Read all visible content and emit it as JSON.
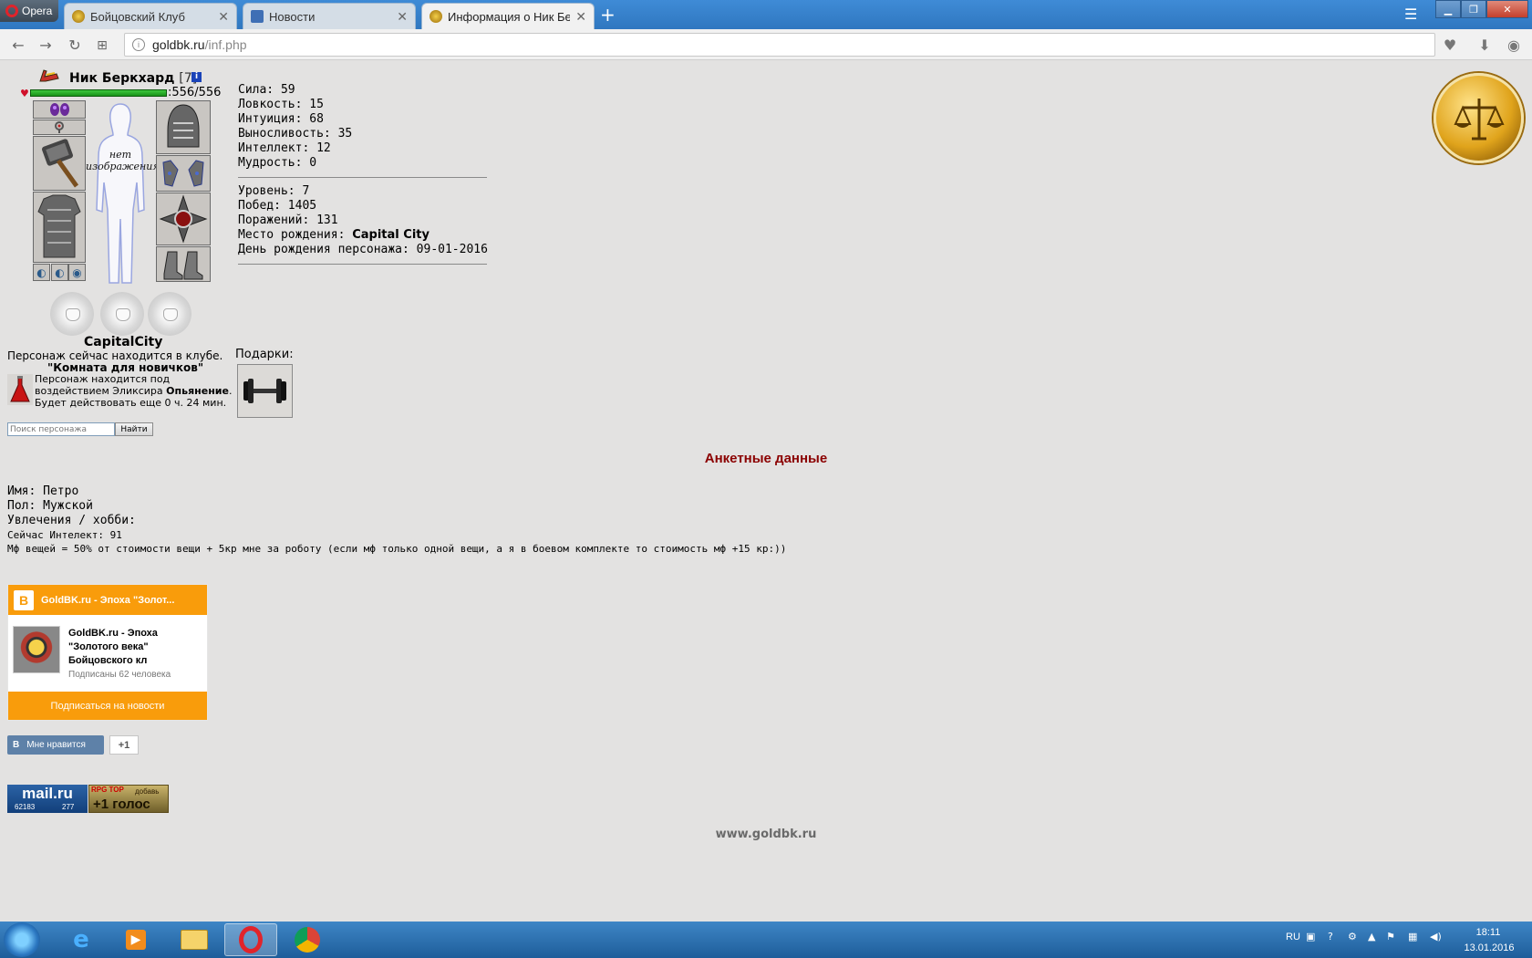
{
  "browser": {
    "menu_label": "Opera",
    "tabs": [
      {
        "title": "Бойцовский Клуб"
      },
      {
        "title": "Новости"
      },
      {
        "title": "Информация о Ник Берк"
      }
    ],
    "url_host": "goldbk.ru",
    "url_path": "/inf.php"
  },
  "character": {
    "name": "Ник Беркхард",
    "level": "[7]",
    "hp_text": ":556/556",
    "hp_fraction": 1.0,
    "no_image_text_1": "нет",
    "no_image_text_2": "изображения",
    "city": "CapitalCity",
    "club_line": "Персонаж сейчас находится в клубе.",
    "room": "\"Комната для новичков\"",
    "elixir_1": "Персонаж находится под",
    "elixir_2": "воздействием Эликсира",
    "elixir_name": "Опьянение",
    "elixir_3": "Будет действовать еще 0 ч. 24 мин.",
    "gifts_label": "Подарки:"
  },
  "stats": {
    "strength": "Сила: 59",
    "agility": "Ловкость: 15",
    "intuition": "Интуиция: 68",
    "endurance": "Выносливость: 35",
    "intellect": "Интеллект: 12",
    "wisdom": "Мудрость: 0",
    "level": "Уровень: 7",
    "wins": "Побед: 1405",
    "losses": "Поражений: 131",
    "birthplace_label": "Место рождения: ",
    "birthplace_value": "Capital City",
    "birthday": "День рождения персонажа: 09-01-2016"
  },
  "search": {
    "placeholder": "Поиск персонажа",
    "button": "Найти"
  },
  "anket": {
    "title": "Анкетные данные",
    "name": "Имя: Петро",
    "gender": "Пол: Мужской",
    "hobby": "Увлечения / хобби:",
    "line1": "Сейчас Интелект: 91",
    "line2": "Мф вещей = 50% от стоимости вещи + 5кр мне за роботу (если мф только одной вещи, а я в боевом комплекте то стоимость мф +15 кр:))"
  },
  "vk_widget": {
    "logo": "B",
    "header": "GoldBK.ru - Эпоха \"Золот...",
    "name_1": "GoldBK.ru - Эпоха",
    "name_2": "\"Золотого века\"",
    "name_3": "Бойцовского кл",
    "subscribers": "Подписаны 62 человека",
    "subscribe_button": "Подписаться на новости"
  },
  "like": {
    "logo": "В",
    "label": "Мне нравится",
    "count": "+1"
  },
  "counters": {
    "mailru_logo": "mail.ru",
    "mailru_count1": "62183",
    "mailru_count2": "277",
    "rpg_title": "RPG TOP",
    "rpg_add": "добавь",
    "rpg_vote": "+1 голос"
  },
  "footer": {
    "url": "www.goldbk.ru"
  },
  "taskbar": {
    "lang": "RU",
    "time": "18:11",
    "date": "13.01.2016"
  },
  "colors": {
    "page_bg": "#e3e2e1",
    "anket_title": "#8b0000",
    "vk_orange": "#f99c0b",
    "hp_green": "#1e8a1e"
  }
}
